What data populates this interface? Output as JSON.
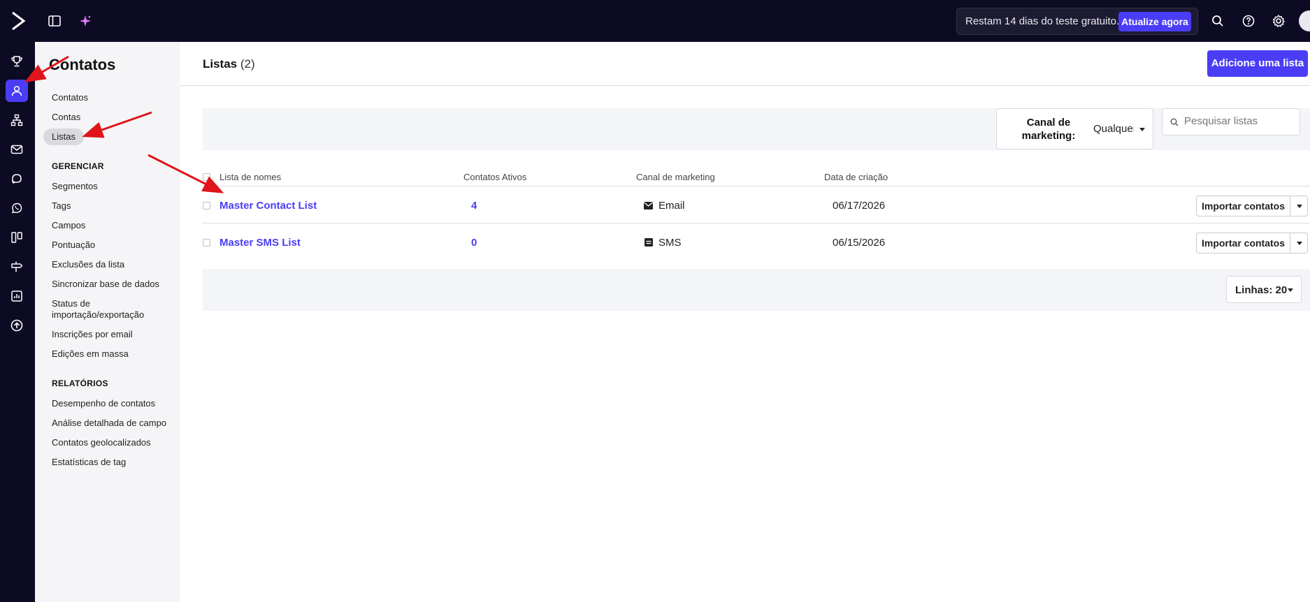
{
  "topbar": {
    "trial_text": "Restam 14 dias do teste gratuito.",
    "upgrade_label": "Atualize agora"
  },
  "sidebar": {
    "title": "Contatos",
    "items": [
      {
        "label": "Contatos"
      },
      {
        "label": "Contas"
      },
      {
        "label": "Listas"
      }
    ],
    "manage_heading": "GERENCIAR",
    "manage_items": [
      {
        "label": "Segmentos"
      },
      {
        "label": "Tags"
      },
      {
        "label": "Campos"
      },
      {
        "label": "Pontuação"
      },
      {
        "label": "Exclusões da lista"
      },
      {
        "label": "Sincronizar base de dados"
      },
      {
        "label": "Status de importação/exportação"
      },
      {
        "label": "Inscrições por email"
      },
      {
        "label": "Edições em massa"
      }
    ],
    "reports_heading": "RELATÓRIOS",
    "report_items": [
      {
        "label": "Desempenho de contatos"
      },
      {
        "label": "Análise detalhada de campo"
      },
      {
        "label": "Contatos geolocalizados"
      },
      {
        "label": "Estatísticas de tag"
      }
    ]
  },
  "main": {
    "title": "Listas",
    "count": "(2)",
    "add_button": "Adicione uma lista",
    "filter": {
      "channel_label": "Canal de marketing:",
      "channel_value": "Qualquer",
      "search_placeholder": "Pesquisar listas"
    },
    "table": {
      "columns": [
        "Lista de nomes",
        "Contatos Ativos",
        "Canal de marketing",
        "Data de criação"
      ],
      "rows": [
        {
          "name": "Master Contact List",
          "active": "4",
          "channel": "Email",
          "channel_icon": "envelope-icon",
          "date": "06/17/2026",
          "action": "Importar contatos"
        },
        {
          "name": "Master SMS List",
          "active": "0",
          "channel": "SMS",
          "channel_icon": "sms-icon",
          "date": "06/15/2026",
          "action": "Importar contatos"
        }
      ]
    },
    "pagination": {
      "rows_label": "Linhas: 20"
    }
  },
  "colors": {
    "nav_bg": "#0d0b24",
    "accent": "#4a3df5",
    "annotation_arrow": "#e0141b"
  }
}
